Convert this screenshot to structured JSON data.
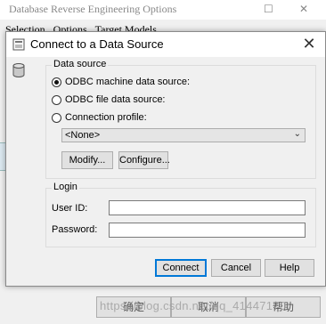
{
  "background_window": {
    "title": "Database Reverse Engineering Options",
    "tabs": [
      "Selection",
      "Options",
      "Target Models"
    ],
    "buttons": [
      "确定",
      "取消",
      "帮助"
    ],
    "watermark": "https://blog.csdn.net/qq_41447170"
  },
  "dialog": {
    "title": "Connect to a Data Source",
    "data_source_group_label": "Data source",
    "radios": [
      {
        "label": "ODBC machine data source:",
        "checked": true
      },
      {
        "label": "ODBC file data source:",
        "checked": false
      },
      {
        "label": "Connection profile:",
        "checked": false
      }
    ],
    "select_value": "<None>",
    "modify_label": "Modify...",
    "configure_label": "Configure...",
    "login_group_label": "Login",
    "user_id_label": "User ID:",
    "user_id_value": "",
    "password_label": "Password:",
    "password_value": "",
    "connect_label": "Connect",
    "cancel_label": "Cancel",
    "help_label": "Help"
  },
  "colors": {
    "dialog_bg": "#f0f0f0",
    "default_button_border": "#0078d7"
  }
}
